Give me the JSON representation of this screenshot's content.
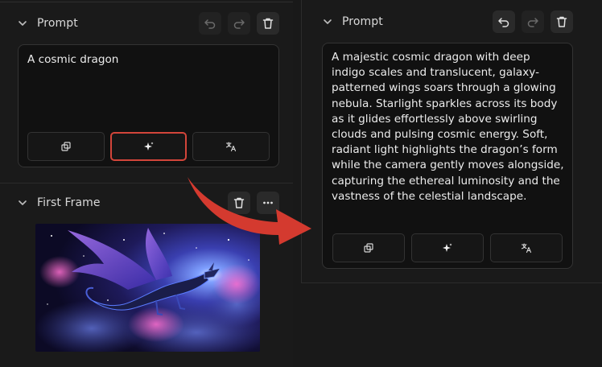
{
  "left": {
    "prompt_section": {
      "title": "Prompt",
      "text": "A cosmic dragon",
      "header_icons": [
        "undo-icon",
        "redo-icon",
        "trash-icon"
      ],
      "tool_icons": [
        "copy-icon",
        "sparkle-icon",
        "translate-icon"
      ]
    },
    "first_frame_section": {
      "title": "First Frame",
      "header_icons": [
        "trash-icon",
        "more-icon"
      ]
    }
  },
  "right": {
    "prompt_section": {
      "title": "Prompt",
      "text": "A majestic cosmic dragon with deep indigo scales and translucent, galaxy-patterned wings soars through a glowing nebula. Starlight sparkles across its body as it glides effortlessly above swirling clouds and pulsing cosmic energy. Soft, radiant light highlights the dragon’s form while the camera gently moves alongside, capturing the ethereal luminosity and the vastness of the celestial landscape.",
      "header_icons": [
        "undo-icon",
        "redo-icon",
        "trash-icon"
      ],
      "tool_icons": [
        "copy-icon",
        "sparkle-icon",
        "translate-icon"
      ]
    }
  },
  "colors": {
    "background": "#191919",
    "text": "#e6e6e6",
    "highlight_border": "#d2453a",
    "arrow": "#d43a2f"
  }
}
